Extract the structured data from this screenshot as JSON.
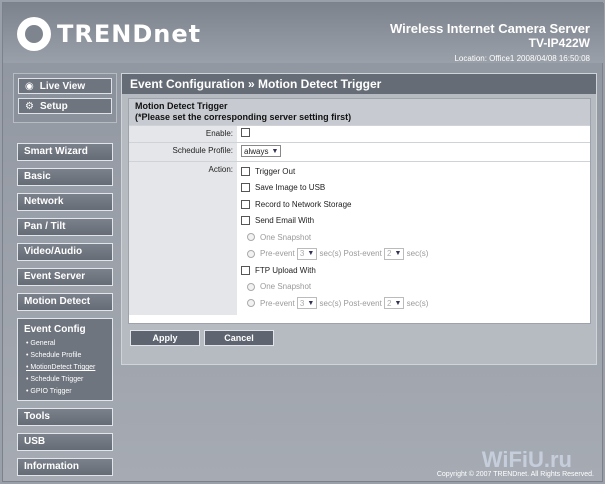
{
  "brand": {
    "logo_text": "TRENDnet"
  },
  "product": {
    "name": "Wireless Internet Camera Server",
    "model": "TV-IP422W"
  },
  "location_text": "Location: Office1   2008/04/08 16:50:08",
  "view": {
    "live_view": "Live View",
    "setup": "Setup"
  },
  "menu": {
    "top": [
      "Smart Wizard",
      "Basic",
      "Network",
      "Pan / Tilt",
      "Video/Audio",
      "Event Server",
      "Motion Detect"
    ],
    "event_config": {
      "title": "Event Config",
      "items": [
        "• General",
        "• Schedule Profile",
        "• MotionDetect Trigger",
        "• Schedule Trigger",
        "• GPIO Trigger"
      ]
    },
    "bottom": [
      "Tools",
      "USB",
      "Information"
    ]
  },
  "page": {
    "title": "Event Configuration » Motion Detect Trigger",
    "section_title": "Motion Detect Trigger",
    "section_note": "(*Please set the corresponding server setting first)"
  },
  "form": {
    "enable_label": "Enable:",
    "schedule_label": "Schedule Profile:",
    "schedule_value": "always",
    "action_label": "Action:",
    "trigger_out": "Trigger Out",
    "save_usb": "Save Image to USB",
    "record_nas": "Record to Network Storage",
    "send_email": "Send Email With",
    "ftp_upload": "FTP Upload With",
    "one_snapshot": "One Snapshot",
    "pre_event": "Pre-event",
    "pre_value": "3",
    "sec_post": "sec(s)  Post-event",
    "post_value": "2",
    "secs": "sec(s)"
  },
  "buttons": {
    "apply": "Apply",
    "cancel": "Cancel"
  },
  "footer": {
    "copyright": "Copyright © 2007 TRENDnet. All Rights Reserved."
  },
  "watermark": "WiFiU.ru",
  "icons": {
    "live_view": "eye-icon",
    "setup": "gear-icon",
    "dropdown": "chevron-down-icon"
  }
}
